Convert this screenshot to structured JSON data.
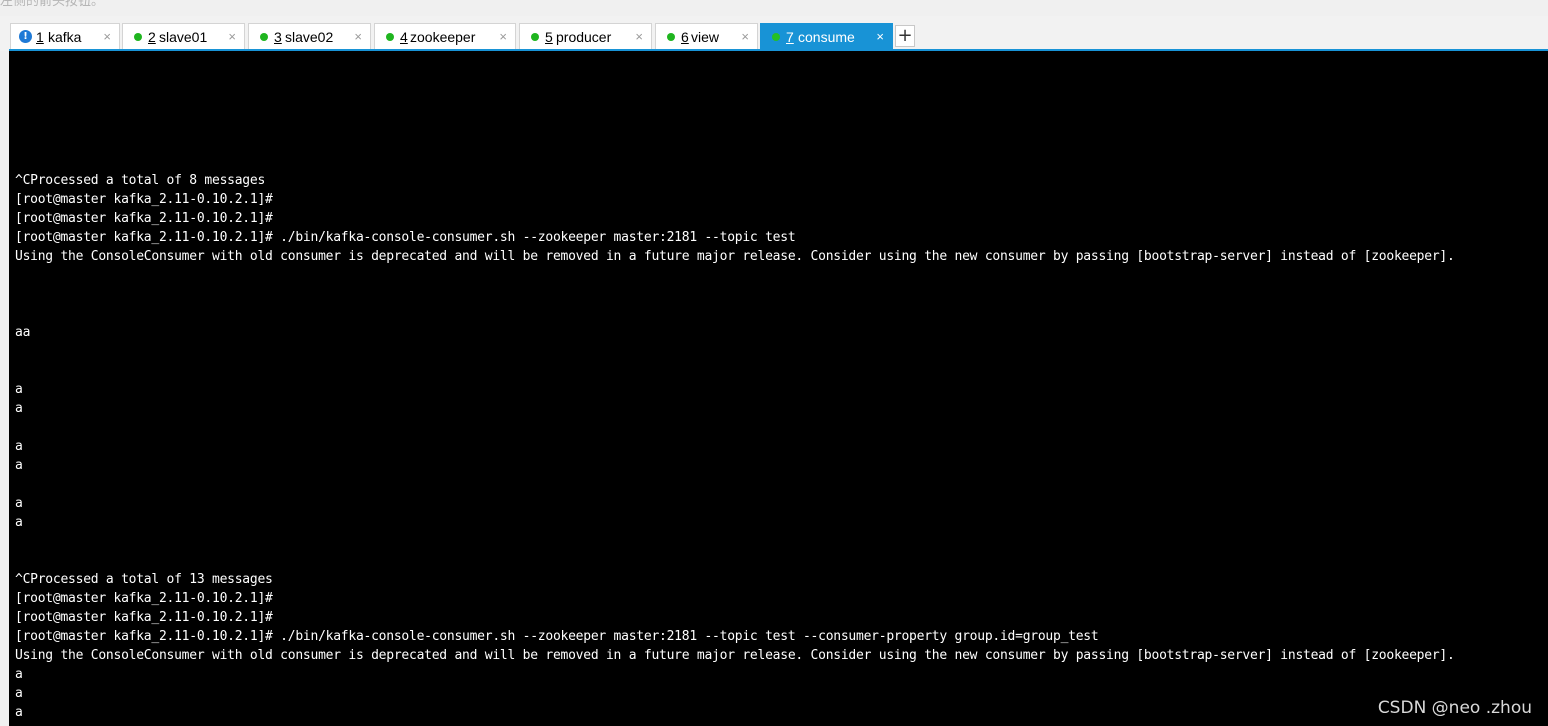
{
  "top_text": "左侧的箭头按钮。",
  "tabs": [
    {
      "num": "1",
      "label": "kafka",
      "status": "alert"
    },
    {
      "num": "2",
      "label": "slave01",
      "status": "connected"
    },
    {
      "num": "3",
      "label": "slave02",
      "status": "connected"
    },
    {
      "num": "4",
      "label": "zookeeper",
      "status": "connected"
    },
    {
      "num": "5",
      "label": "producer",
      "status": "connected"
    },
    {
      "num": "6",
      "label": "view",
      "status": "connected"
    },
    {
      "num": "7",
      "label": "consume",
      "status": "connected",
      "active": true
    }
  ],
  "tab_close_glyph": "×",
  "add_tab_glyph": "+",
  "terminal_lines": [
    "^CProcessed a total of 8 messages",
    "[root@master kafka_2.11-0.10.2.1]#",
    "[root@master kafka_2.11-0.10.2.1]#",
    "[root@master kafka_2.11-0.10.2.1]# ./bin/kafka-console-consumer.sh --zookeeper master:2181 --topic test",
    "Using the ConsoleConsumer with old consumer is deprecated and will be removed in a future major release. Consider using the new consumer by passing [bootstrap-server] instead of [zookeeper].",
    "aa",
    "a",
    "a",
    "a",
    "a",
    "a",
    "a",
    "^CProcessed a total of 13 messages",
    "[root@master kafka_2.11-0.10.2.1]#",
    "[root@master kafka_2.11-0.10.2.1]#",
    "[root@master kafka_2.11-0.10.2.1]# ./bin/kafka-console-consumer.sh --zookeeper master:2181 --topic test --consumer-property group.id=group_test",
    "Using the ConsoleConsumer with old consumer is deprecated and will be removed in a future major release. Consider using the new consumer by passing [bootstrap-server] instead of [zookeeper].",
    "a",
    "a",
    "a"
  ],
  "watermark": "CSDN @neo .zhou",
  "colors": {
    "active_tab": "#1893d6",
    "status_dot": "#1fb51f",
    "alert_icon": "#1f7ad6",
    "terminal_bg": "#000000",
    "terminal_fg": "#ffffff"
  }
}
